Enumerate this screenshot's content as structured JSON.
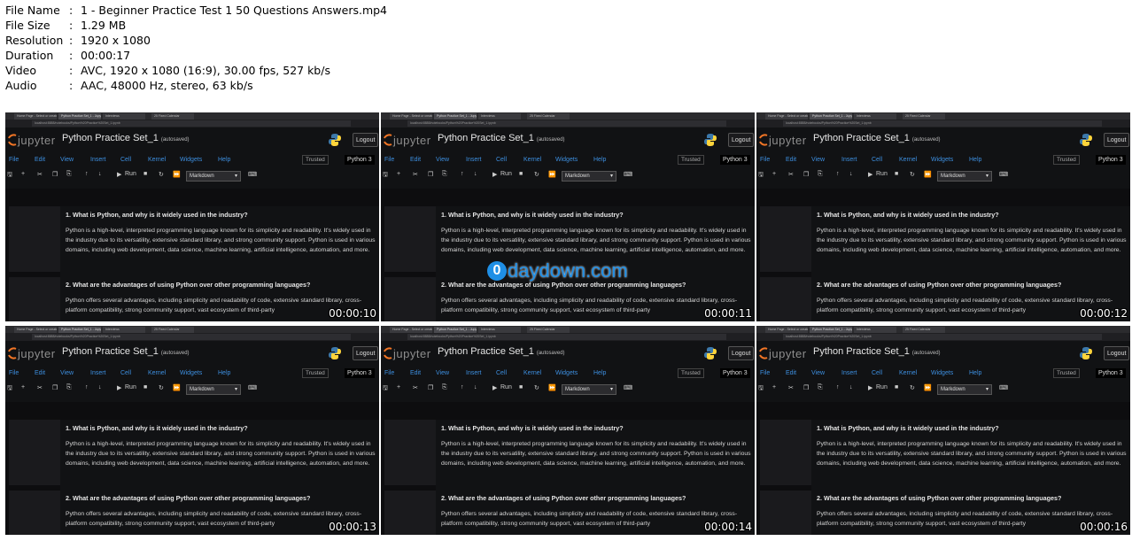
{
  "info": [
    {
      "key": "File Name",
      "sep": ":",
      "value": "1 - Beginner Practice Test 1 50 Questions Answers.mp4"
    },
    {
      "key": "File Size",
      "sep": ":",
      "value": "1.29 MB"
    },
    {
      "key": "Resolution",
      "sep": ":",
      "value": "1920 x 1080"
    },
    {
      "key": "Duration",
      "sep": ":",
      "value": "00:00:17"
    },
    {
      "key": "Video",
      "sep": ":",
      "value": "AVC, 1920 x 1080 (16:9), 30.00 fps, 527 kb/s"
    },
    {
      "key": "Audio",
      "sep": ":",
      "value": "AAC, 48000 Hz, stereo, 63 kb/s"
    }
  ],
  "thumb": {
    "tabs": [
      "Home Page - Select or create",
      "Python Practice Set_1 - Jupyt",
      "Interviews",
      "25 Fixed Calendar"
    ],
    "url": "localhost:8888/notebooks/Python%20Practice%20Set_1.ipynb",
    "brand": "jupyter",
    "notebook_title": "Python Practice Set_1",
    "autosaved": "(autosaved)",
    "logout": "Logout",
    "menu": [
      "File",
      "Edit",
      "View",
      "Insert",
      "Cell",
      "Kernel",
      "Widgets",
      "Help"
    ],
    "trusted": "Trusted",
    "kernel": "Python 3",
    "run_label": "Run",
    "cell_type": "Markdown",
    "q1": "1. What is Python, and why is it widely used in the industry?",
    "a1": "Python is a high-level, interpreted programming language known for its simplicity and readability. It's widely used in the industry due to its versatility, extensive standard library, and strong community support. Python is used in various domains, including web development, data science, machine learning, artificial intelligence, automation, and more.",
    "q2": "2. What are the advantages of using Python over other programming languages?",
    "a2": "Python offers several advantages, including simplicity and readability of code, extensive standard library, cross-platform compatibility, strong community support, vast ecosystem of third-party"
  },
  "timestamps": [
    "00:00:10",
    "00:00:11",
    "00:00:12",
    "00:00:13",
    "00:00:14",
    "00:00:16"
  ],
  "watermark": {
    "circle": "0",
    "text": "daydown.com"
  },
  "colors": {
    "link": "#3d8fe0",
    "watermark": "#1f8fe6",
    "bg": "#111214"
  }
}
